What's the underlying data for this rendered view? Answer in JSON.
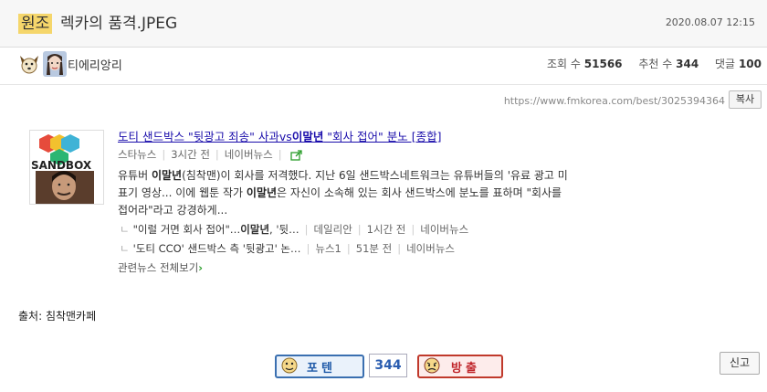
{
  "post": {
    "tag": "원조",
    "title": "렉카의 품격.JPEG",
    "date": "2020.08.07 12:15"
  },
  "author": {
    "name": "티에리앙리"
  },
  "stats": {
    "views_label": "조회 수",
    "views": "51566",
    "recommend_label": "추천 수",
    "recommend": "344",
    "comments_label": "댓글",
    "comments": "100"
  },
  "url": {
    "text": "https://www.fmkorea.com/best/3025394364",
    "copy_label": "복사"
  },
  "news": {
    "thumb_text": "SANDBOX",
    "title_a": "도티 샌드박스 \"뒷광고 죄송\" 사과vs",
    "title_bold": "이말년",
    "title_b": " \"회사 접어\" 분노 [종합]",
    "source": "스타뉴스",
    "time": "3시간 전",
    "portal": "네이버뉴스",
    "body_1": "유튜버 ",
    "body_bold1": "이말년",
    "body_2": "(침착맨)이 회사를 저격했다. 지난 6일 샌드박스네트워크는 유튜버들의 '유료 광고 미표기 영상... 이에 웹툰 작가 ",
    "body_bold2": "이말년",
    "body_3": "은 자신이 소속해 있는 회사 샌드박스에 분노를 표하며 \"회사를 접어라\"라고 강경하게...",
    "related": [
      {
        "mark": "ㄴ",
        "text_a": "\"이럴 거면 회사 접어\"…",
        "bold": "이말년",
        "text_b": ", '뒷…",
        "source": "데일리안",
        "time": "1시간 전",
        "portal": "네이버뉴스"
      },
      {
        "mark": "ㄴ",
        "text_a": "'도티 CCO' 샌드박스 측 '뒷광고' 논…",
        "bold": "",
        "text_b": "",
        "source": "뉴스1",
        "time": "51분 전",
        "portal": "네이버뉴스"
      }
    ],
    "related_all": "관련뉴스 전체보기"
  },
  "footer": {
    "source": "출처: 침착맨카페",
    "upvote": "포텐",
    "vote_count": "344",
    "downvote": "방출",
    "report": "신고"
  },
  "colors": {
    "tag_bg": "#f5d66b",
    "link": "#1a0dab",
    "upvote": "#3a6fb0",
    "downvote": "#c0392b"
  }
}
